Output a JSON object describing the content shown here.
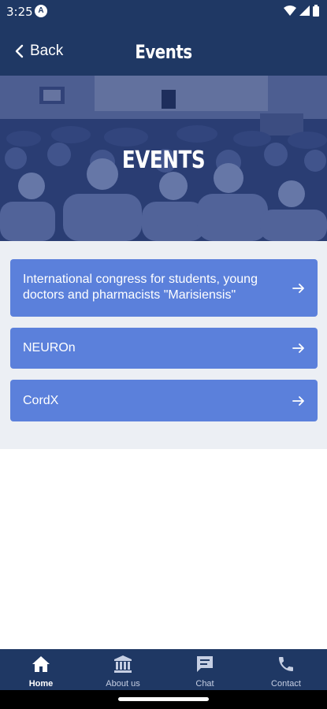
{
  "status_bar": {
    "time": "3:25"
  },
  "app_bar": {
    "back_label": "Back",
    "title": "Events"
  },
  "hero": {
    "title": "EVENTS"
  },
  "events": [
    {
      "label": "International congress for students, young doctors and pharmacists \"Marisiensis\""
    },
    {
      "label": "NEUROn"
    },
    {
      "label": "CordX"
    }
  ],
  "bottom_nav": {
    "items": [
      {
        "label": "Home",
        "icon": "home-icon",
        "active": true
      },
      {
        "label": "About us",
        "icon": "bank-icon",
        "active": false
      },
      {
        "label": "Chat",
        "icon": "chat-icon",
        "active": false
      },
      {
        "label": "Contact",
        "icon": "phone-icon",
        "active": false
      }
    ]
  },
  "colors": {
    "primary_dark": "#1f3864",
    "card_blue": "#5b80db",
    "list_background": "#eceff4"
  }
}
